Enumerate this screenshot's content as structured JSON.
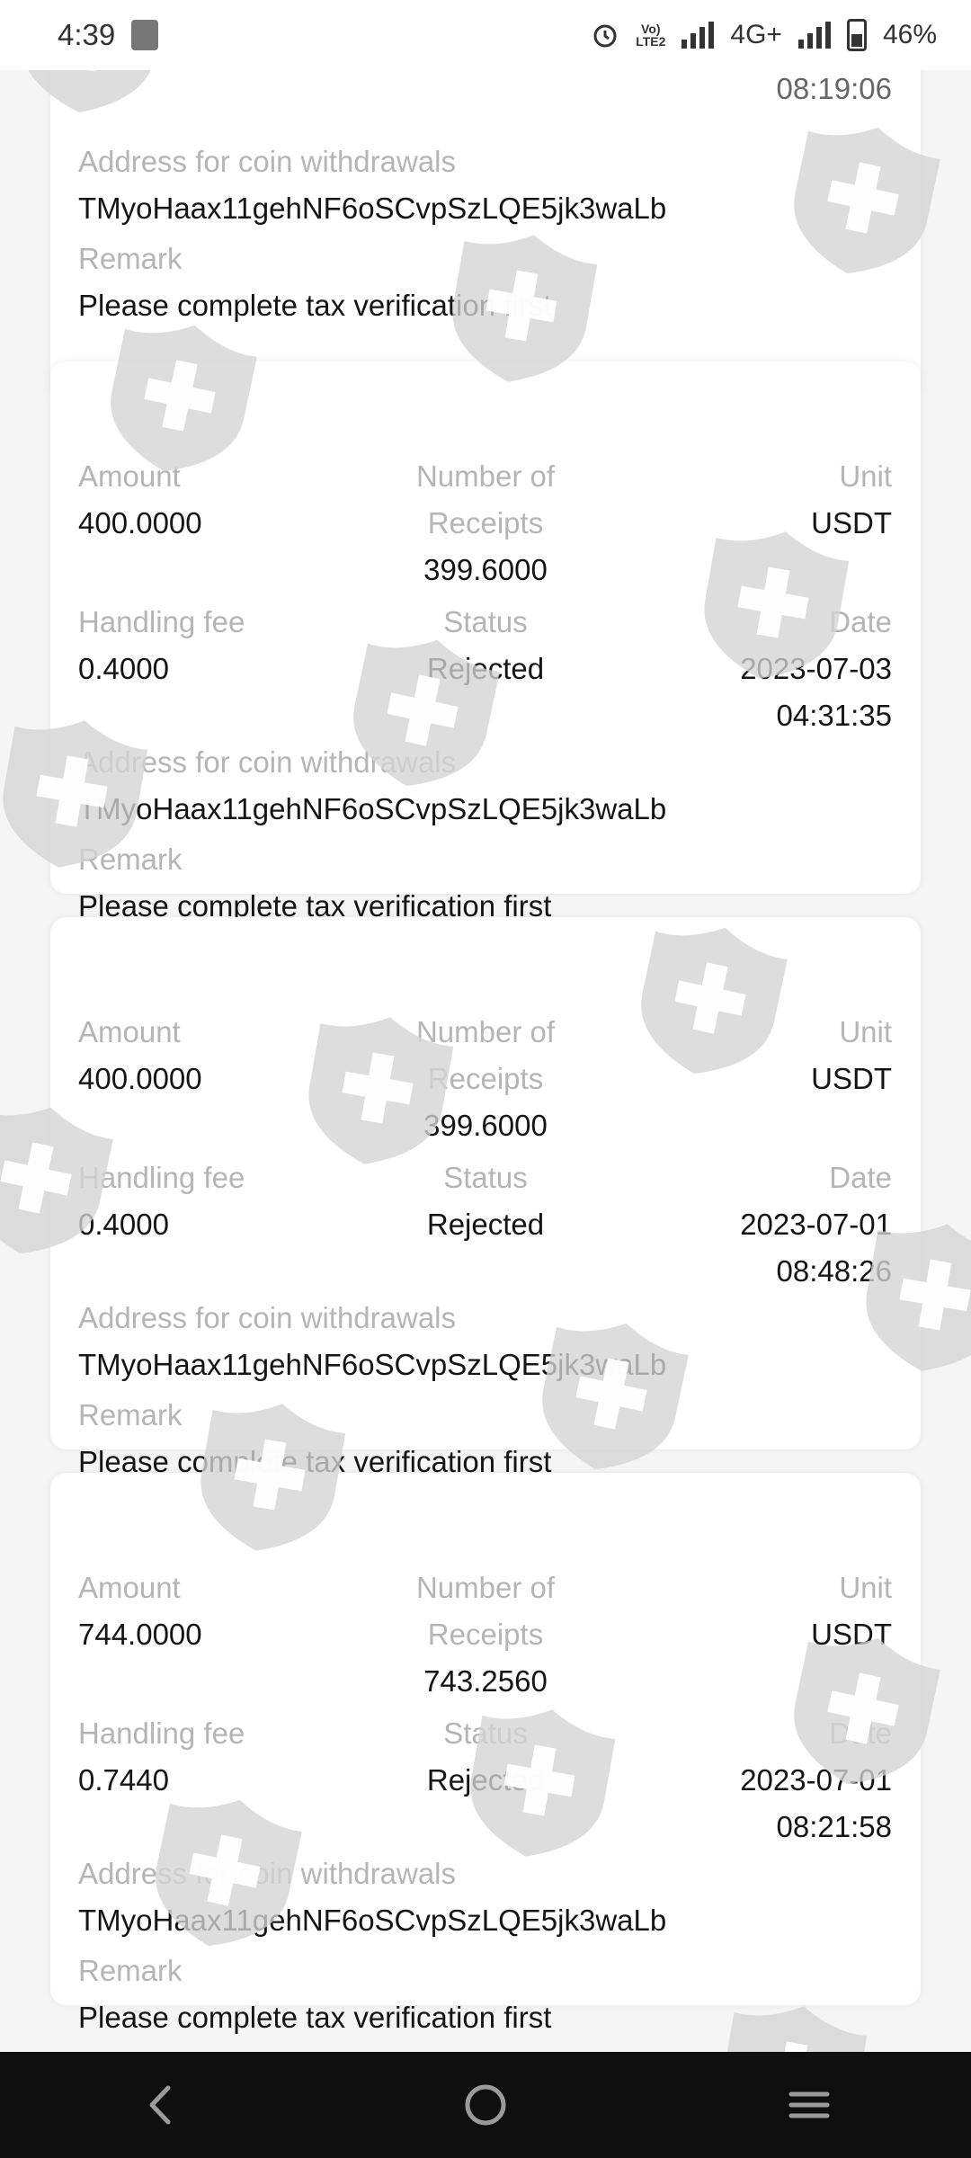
{
  "status_bar": {
    "time": "4:39",
    "network": "4G+",
    "lte_label": "Vo))\nLTE2",
    "battery": "46%"
  },
  "partial_card": {
    "address_label": "Address for coin withdrawals",
    "address": "TMyoHaax11gehNF6oSCvpSzLQE5jk3waLb",
    "remark_label": "Remark",
    "remark": "Please complete tax verification first"
  },
  "labels": {
    "amount": "Amount",
    "receipts_1": "Number of",
    "receipts_2": "Receipts",
    "unit": "Unit",
    "fee": "Handling fee",
    "status": "Status",
    "date": "Date",
    "address": "Address for coin withdrawals",
    "remark": "Remark"
  },
  "records": [
    {
      "amount": "400.0000",
      "receipts": "399.6000",
      "unit": "USDT",
      "fee": "0.4000",
      "status": "Rejected",
      "date": "2023-07-03",
      "time": "04:31:35",
      "address": "TMyoHaax11gehNF6oSCvpSzLQE5jk3waLb",
      "remark": "Please complete tax verification first"
    },
    {
      "amount": "400.0000",
      "receipts": "399.6000",
      "unit": "USDT",
      "fee": "0.4000",
      "status": "Rejected",
      "date": "2023-07-01",
      "time": "08:48:26",
      "address": "TMyoHaax11gehNF6oSCvpSzLQE5jk3waLb",
      "remark": "Please complete tax verification first"
    },
    {
      "amount": "744.0000",
      "receipts": "743.2560",
      "unit": "USDT",
      "fee": "0.7440",
      "status": "Rejected",
      "date": "2023-07-01",
      "time": "08:21:58",
      "address": "TMyoHaax11gehNF6oSCvpSzLQE5jk3waLb",
      "remark": "Please complete tax verification first"
    }
  ],
  "nav": {
    "back_icon": "back-icon",
    "home_icon": "home-icon",
    "recents_icon": "recents-icon"
  },
  "colors": {
    "label_gray": "#b5b5b5",
    "nav_bg": "#0f0f0f",
    "watermark": "#d4d4d4"
  }
}
